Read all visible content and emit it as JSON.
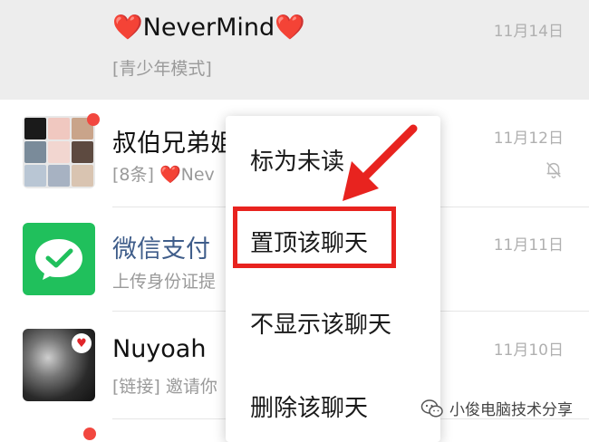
{
  "chats": [
    {
      "name": "NeverMind",
      "heart_left": "❤️",
      "heart_right": "❤️",
      "preview": "[青少年模式]",
      "time": "11月14日",
      "pinned": true
    },
    {
      "name": "叔伯兄弟姐",
      "preview_count": "[8条]",
      "preview_heart": "❤️",
      "preview_text": "Nev",
      "time": "11月12日",
      "muted": true,
      "unread_dot": true
    },
    {
      "name": "微信支付",
      "preview": "上传身份证提",
      "time": "11月11日",
      "name_color": "#3f5d8a"
    },
    {
      "name": "Nuyoah",
      "preview": "[链接] 邀请你",
      "time": "11月10日",
      "avatar_badge": "heart-icon"
    }
  ],
  "context_menu": {
    "items": [
      "标为未读",
      "置顶该聊天",
      "不显示该聊天",
      "删除该聊天"
    ],
    "highlighted_index": 1
  },
  "watermark": {
    "text": "小俊电脑技术分享",
    "icon": "wechat-icon"
  },
  "colors": {
    "pinned_bg": "#ededed",
    "highlight": "#e8231f",
    "wechat_pay_green": "#20c05c",
    "unread_dot": "#f2473f"
  }
}
